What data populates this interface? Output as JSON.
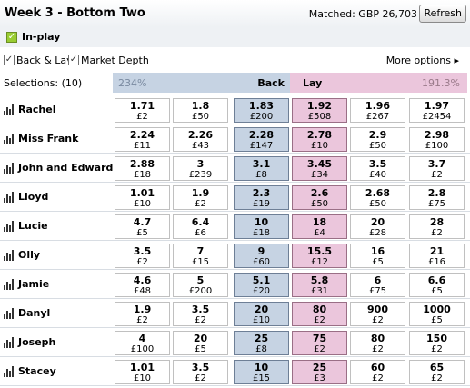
{
  "header": {
    "title": "Week 3 - Bottom Two",
    "matched": "Matched: GBP 26,703",
    "refresh_label": "Refresh"
  },
  "inplay": {
    "label": "In-play"
  },
  "options": {
    "back_lay_label": "Back & Lay",
    "market_depth_label": "Market Depth",
    "more_options_label": "More options ▸"
  },
  "market": {
    "selections_label": "Selections:  (10)",
    "back_pct": "234%",
    "back_label": "Back",
    "lay_label": "Lay",
    "lay_pct": "191.3%"
  },
  "runners": [
    {
      "name": "Rachel",
      "odds": [
        [
          "1.71",
          "£2"
        ],
        [
          "1.8",
          "£50"
        ],
        [
          "1.83",
          "£200"
        ],
        [
          "1.92",
          "£508"
        ],
        [
          "1.96",
          "£267"
        ],
        [
          "1.97",
          "£2454"
        ]
      ]
    },
    {
      "name": "Miss Frank",
      "odds": [
        [
          "2.24",
          "£11"
        ],
        [
          "2.26",
          "£43"
        ],
        [
          "2.28",
          "£147"
        ],
        [
          "2.78",
          "£10"
        ],
        [
          "2.9",
          "£50"
        ],
        [
          "2.98",
          "£100"
        ]
      ]
    },
    {
      "name": "John and Edward",
      "odds": [
        [
          "2.88",
          "£18"
        ],
        [
          "3",
          "£239"
        ],
        [
          "3.1",
          "£8"
        ],
        [
          "3.45",
          "£34"
        ],
        [
          "3.5",
          "£40"
        ],
        [
          "3.7",
          "£2"
        ]
      ]
    },
    {
      "name": "Lloyd",
      "odds": [
        [
          "1.01",
          "£10"
        ],
        [
          "1.9",
          "£2"
        ],
        [
          "2.3",
          "£19"
        ],
        [
          "2.6",
          "£50"
        ],
        [
          "2.68",
          "£50"
        ],
        [
          "2.8",
          "£75"
        ]
      ]
    },
    {
      "name": "Lucie",
      "odds": [
        [
          "4.7",
          "£5"
        ],
        [
          "6.4",
          "£6"
        ],
        [
          "10",
          "£18"
        ],
        [
          "18",
          "£4"
        ],
        [
          "20",
          "£28"
        ],
        [
          "28",
          "£2"
        ]
      ]
    },
    {
      "name": "Olly",
      "odds": [
        [
          "3.5",
          "£2"
        ],
        [
          "7",
          "£15"
        ],
        [
          "9",
          "£60"
        ],
        [
          "15.5",
          "£12"
        ],
        [
          "16",
          "£5"
        ],
        [
          "21",
          "£16"
        ]
      ]
    },
    {
      "name": "Jamie",
      "odds": [
        [
          "4.6",
          "£48"
        ],
        [
          "5",
          "£200"
        ],
        [
          "5.1",
          "£20"
        ],
        [
          "5.8",
          "£31"
        ],
        [
          "6",
          "£75"
        ],
        [
          "6.6",
          "£5"
        ]
      ]
    },
    {
      "name": "Danyl",
      "odds": [
        [
          "1.9",
          "£2"
        ],
        [
          "3.5",
          "£2"
        ],
        [
          "20",
          "£10"
        ],
        [
          "80",
          "£2"
        ],
        [
          "900",
          "£2"
        ],
        [
          "1000",
          "£5"
        ]
      ]
    },
    {
      "name": "Joseph",
      "odds": [
        [
          "4",
          "£100"
        ],
        [
          "20",
          "£5"
        ],
        [
          "25",
          "£8"
        ],
        [
          "75",
          "£2"
        ],
        [
          "80",
          "£2"
        ],
        [
          "150",
          "£2"
        ]
      ]
    },
    {
      "name": "Stacey",
      "odds": [
        [
          "1.01",
          "£10"
        ],
        [
          "3.5",
          "£2"
        ],
        [
          "10",
          "£15"
        ],
        [
          "25",
          "£3"
        ],
        [
          "60",
          "£2"
        ],
        [
          "65",
          "£2"
        ]
      ]
    }
  ],
  "colors": {
    "back": "#c6d3e3",
    "lay": "#ebc6dc"
  }
}
